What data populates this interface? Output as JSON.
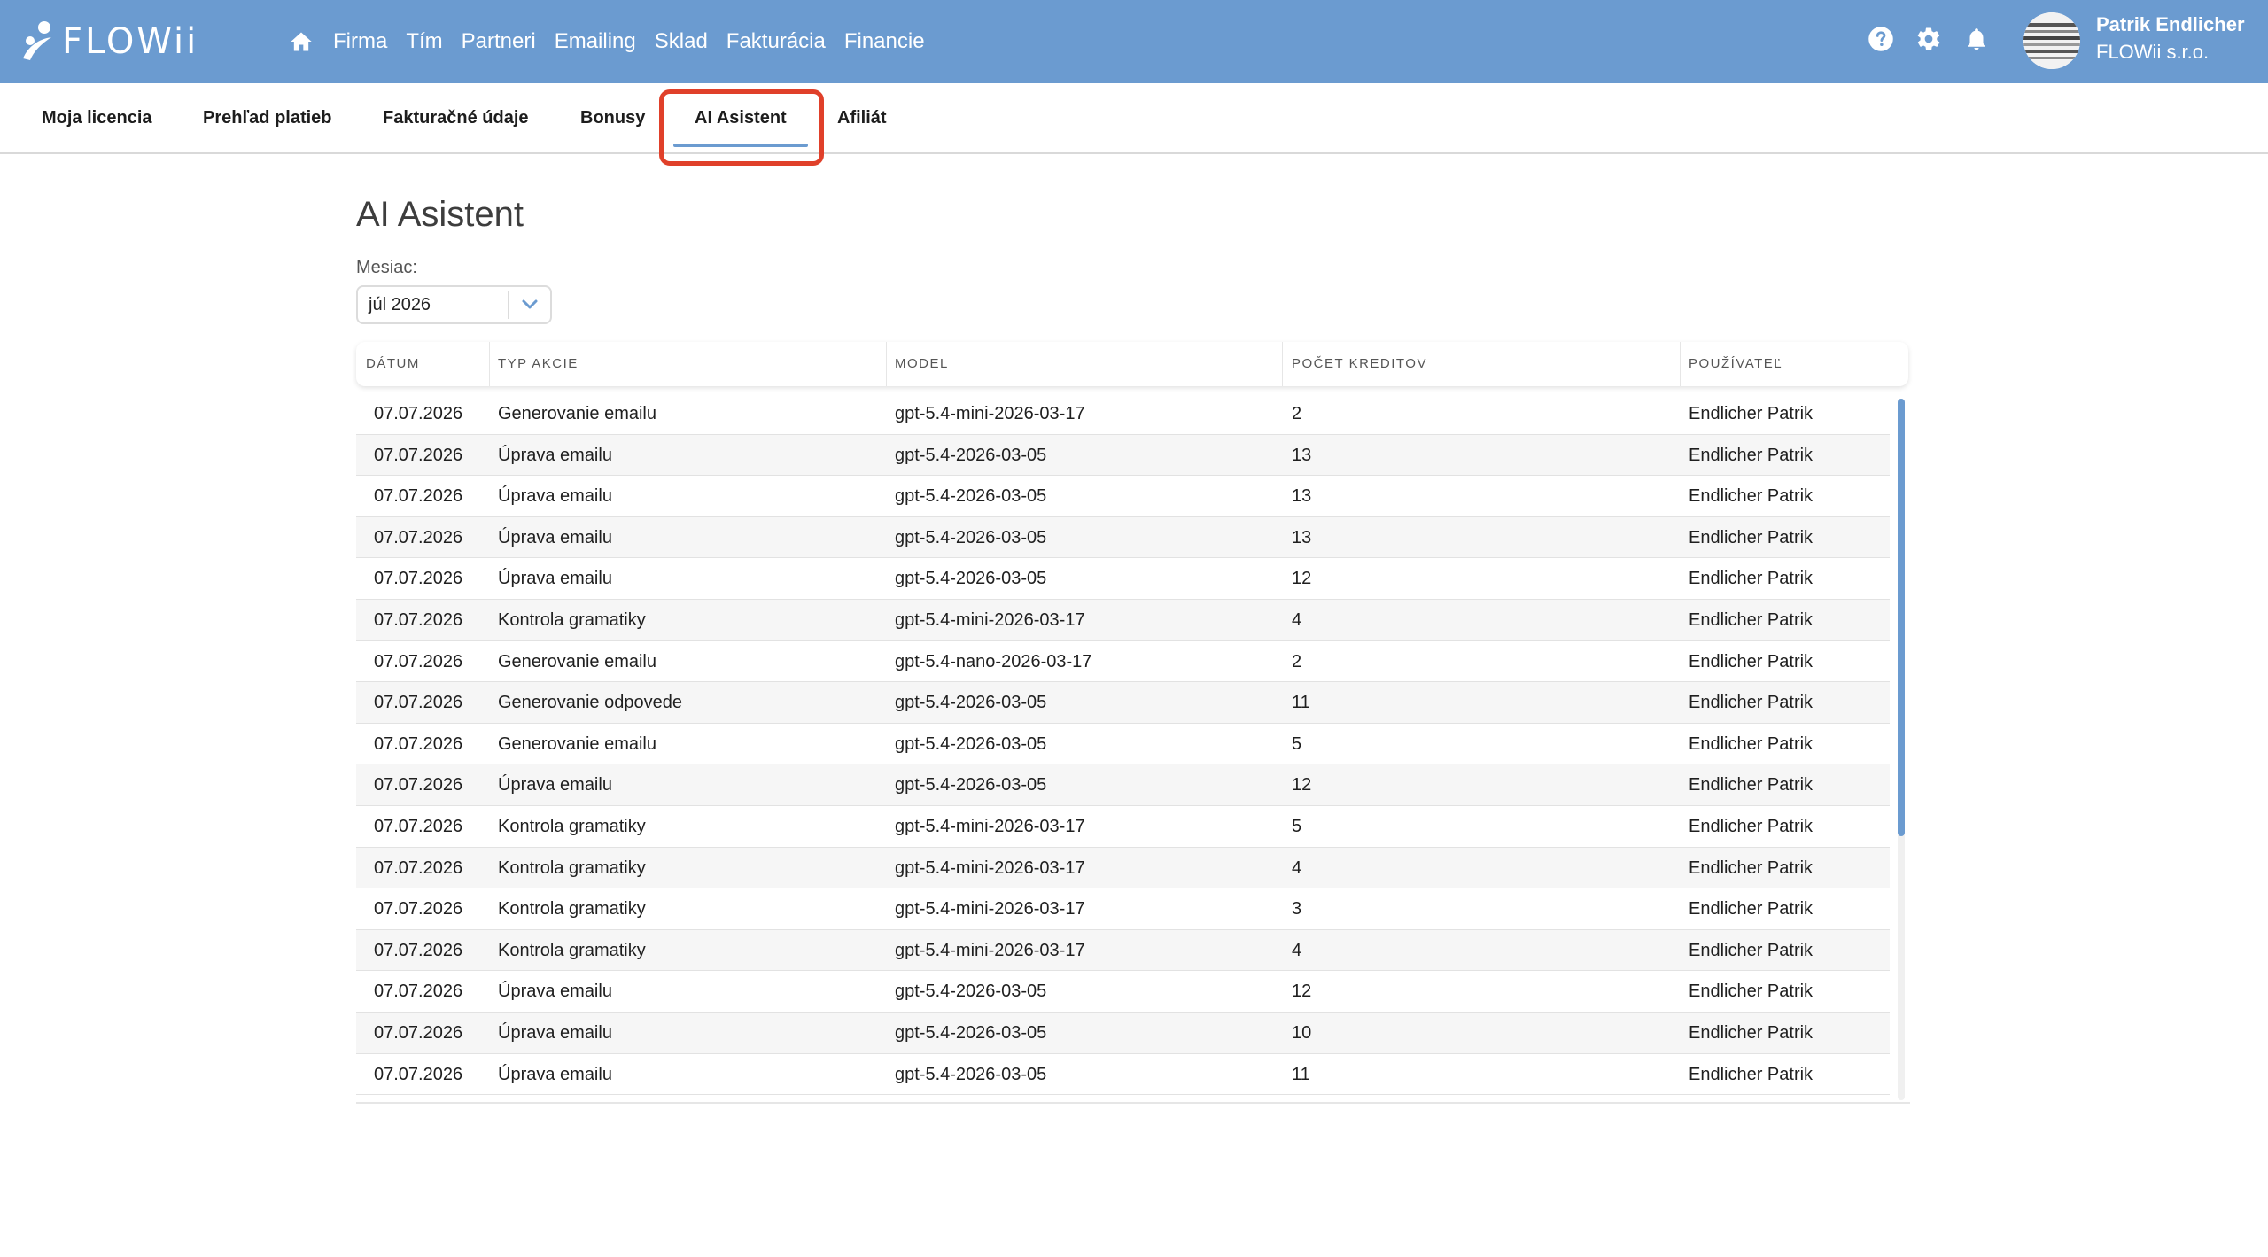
{
  "app": {
    "logo_text": "FLOWii",
    "accent_color": "#6b9bd0",
    "highlight_color": "#e0402a"
  },
  "nav": {
    "home_icon": "home-icon",
    "items": [
      "Firma",
      "Tím",
      "Partneri",
      "Emailing",
      "Sklad",
      "Fakturácia",
      "Financie"
    ]
  },
  "top_icons": [
    "help-icon",
    "gear-icon",
    "bell-icon"
  ],
  "user": {
    "name": "Patrik Endlicher",
    "company": "FLOWii s.r.o."
  },
  "tabs": {
    "items": [
      "Moja licencia",
      "Prehľad platieb",
      "Fakturačné údaje",
      "Bonusy",
      "AI Asistent",
      "Afiliát"
    ],
    "active": "AI Asistent"
  },
  "page": {
    "title": "AI Asistent",
    "month_label": "Mesiac:",
    "month_value": "júl 2026"
  },
  "table": {
    "headers": [
      "DÁTUM",
      "TYP AKCIE",
      "MODEL",
      "POČET KREDITOV",
      "POUŽÍVATEĽ"
    ],
    "rows": [
      [
        "07.07.2026",
        "Generovanie emailu",
        "gpt-5.4-mini-2026-03-17",
        "2",
        "Endlicher Patrik"
      ],
      [
        "07.07.2026",
        "Úprava emailu",
        "gpt-5.4-2026-03-05",
        "13",
        "Endlicher Patrik"
      ],
      [
        "07.07.2026",
        "Úprava emailu",
        "gpt-5.4-2026-03-05",
        "13",
        "Endlicher Patrik"
      ],
      [
        "07.07.2026",
        "Úprava emailu",
        "gpt-5.4-2026-03-05",
        "13",
        "Endlicher Patrik"
      ],
      [
        "07.07.2026",
        "Úprava emailu",
        "gpt-5.4-2026-03-05",
        "12",
        "Endlicher Patrik"
      ],
      [
        "07.07.2026",
        "Kontrola gramatiky",
        "gpt-5.4-mini-2026-03-17",
        "4",
        "Endlicher Patrik"
      ],
      [
        "07.07.2026",
        "Generovanie emailu",
        "gpt-5.4-nano-2026-03-17",
        "2",
        "Endlicher Patrik"
      ],
      [
        "07.07.2026",
        "Generovanie odpovede",
        "gpt-5.4-2026-03-05",
        "11",
        "Endlicher Patrik"
      ],
      [
        "07.07.2026",
        "Generovanie emailu",
        "gpt-5.4-2026-03-05",
        "5",
        "Endlicher Patrik"
      ],
      [
        "07.07.2026",
        "Úprava emailu",
        "gpt-5.4-2026-03-05",
        "12",
        "Endlicher Patrik"
      ],
      [
        "07.07.2026",
        "Kontrola gramatiky",
        "gpt-5.4-mini-2026-03-17",
        "5",
        "Endlicher Patrik"
      ],
      [
        "07.07.2026",
        "Kontrola gramatiky",
        "gpt-5.4-mini-2026-03-17",
        "4",
        "Endlicher Patrik"
      ],
      [
        "07.07.2026",
        "Kontrola gramatiky",
        "gpt-5.4-mini-2026-03-17",
        "3",
        "Endlicher Patrik"
      ],
      [
        "07.07.2026",
        "Kontrola gramatiky",
        "gpt-5.4-mini-2026-03-17",
        "4",
        "Endlicher Patrik"
      ],
      [
        "07.07.2026",
        "Úprava emailu",
        "gpt-5.4-2026-03-05",
        "12",
        "Endlicher Patrik"
      ],
      [
        "07.07.2026",
        "Úprava emailu",
        "gpt-5.4-2026-03-05",
        "10",
        "Endlicher Patrik"
      ],
      [
        "07.07.2026",
        "Úprava emailu",
        "gpt-5.4-2026-03-05",
        "11",
        "Endlicher Patrik"
      ]
    ]
  }
}
